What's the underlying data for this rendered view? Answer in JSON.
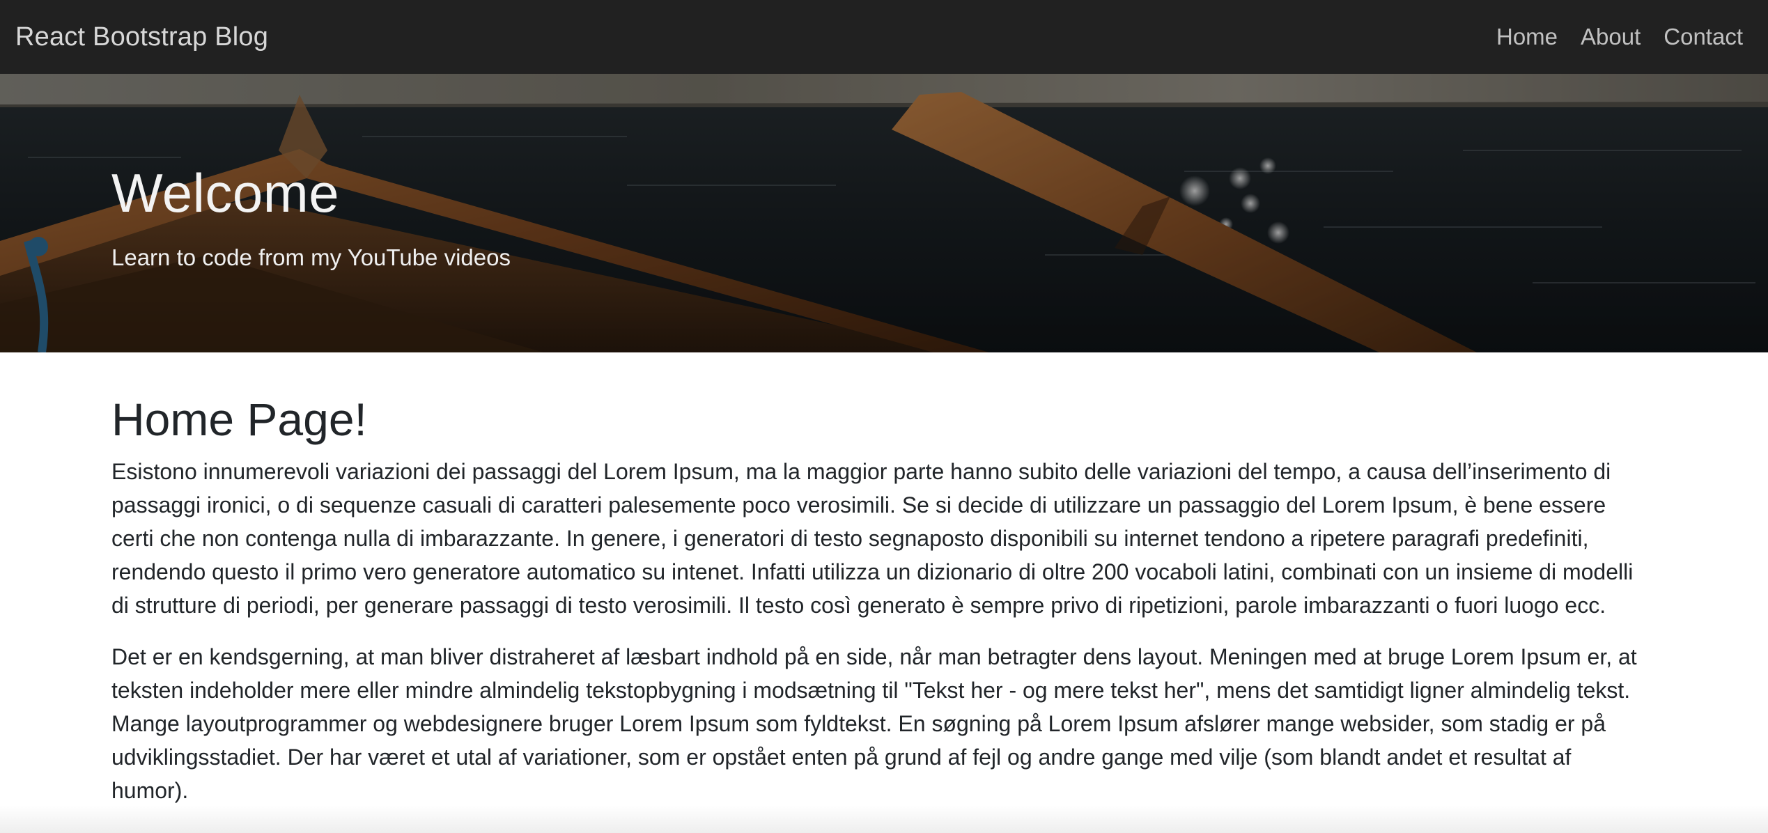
{
  "navbar": {
    "brand": "React Bootstrap Blog",
    "links": [
      "Home",
      "About",
      "Contact"
    ],
    "background": "#212121"
  },
  "hero": {
    "title": "Welcome",
    "subtitle": "Learn to code from my YouTube videos"
  },
  "main": {
    "heading": "Home Page!",
    "paragraphs": [
      "Esistono innumerevoli variazioni dei passaggi del Lorem Ipsum, ma la maggior parte hanno subito delle variazioni del tempo, a causa dell’inserimento di passaggi ironici, o di sequenze casuali di caratteri palesemente poco verosimili. Se si decide di utilizzare un passaggio del Lorem Ipsum, è bene essere certi che non contenga nulla di imbarazzante. In genere, i generatori di testo segnaposto disponibili su internet tendono a ripetere paragrafi predefiniti, rendendo questo il primo vero generatore automatico su intenet. Infatti utilizza un dizionario di oltre 200 vocaboli latini, combinati con un insieme di modelli di strutture di periodi, per generare passaggi di testo verosimili. Il testo così generato è sempre privo di ripetizioni, parole imbarazzanti o fuori luogo ecc.",
      "Det er en kendsgerning, at man bliver distraheret af læsbart indhold på en side, når man betragter dens layout. Meningen med at bruge Lorem Ipsum er, at teksten indeholder mere eller mindre almindelig tekstopbygning i modsætning til \"Tekst her - og mere tekst her\", mens det samtidigt ligner almindelig tekst. Mange layoutprogrammer og webdesignere bruger Lorem Ipsum som fyldtekst. En søgning på Lorem Ipsum afslører mange websider, som stadig er på udviklingsstadiet. Der har været et utal af variationer, som er opstået enten på grund af fejl og andre gange med vilje (som blandt andet et resultat af humor)."
    ]
  }
}
